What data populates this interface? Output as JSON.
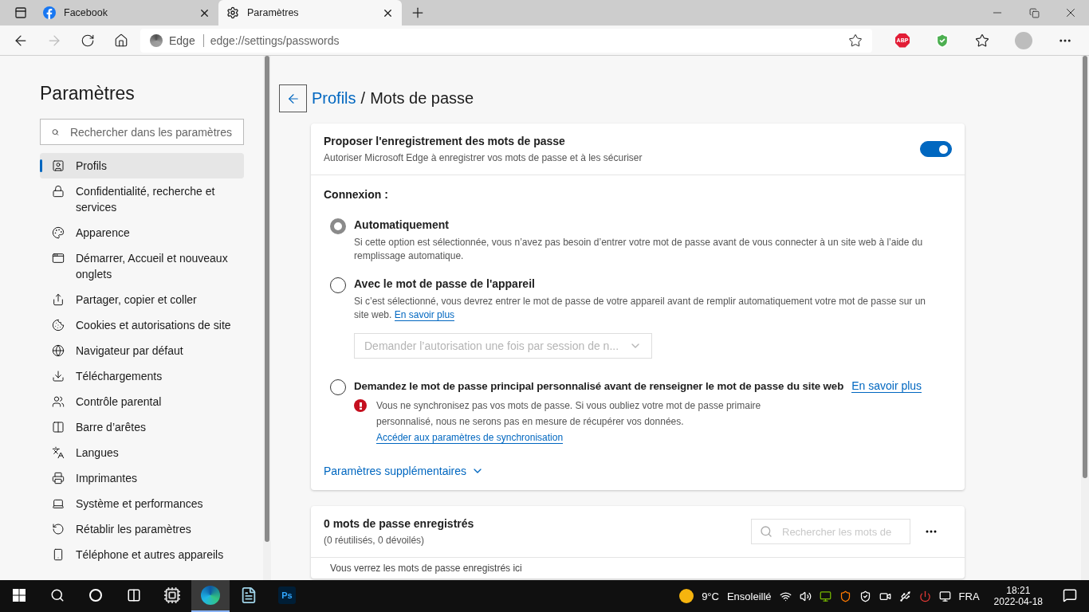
{
  "tabs": [
    {
      "title": "Facebook",
      "selected": false
    },
    {
      "title": "Paramètres",
      "selected": true
    }
  ],
  "address": {
    "site_label": "Edge",
    "url": "edge://settings/passwords",
    "adblock_badge": "ABP"
  },
  "sidebar": {
    "title": "Paramètres",
    "search_placeholder": "Rechercher dans les paramètres",
    "items": [
      {
        "label": "Profils",
        "selected": true
      },
      {
        "label": "Confidentialité, recherche et services",
        "selected": false
      },
      {
        "label": "Apparence",
        "selected": false
      },
      {
        "label": "Démarrer, Accueil et nouveaux onglets",
        "selected": false
      },
      {
        "label": "Partager, copier et coller",
        "selected": false
      },
      {
        "label": "Cookies et autorisations de site",
        "selected": false
      },
      {
        "label": "Navigateur par défaut",
        "selected": false
      },
      {
        "label": "Téléchargements",
        "selected": false
      },
      {
        "label": "Contrôle parental",
        "selected": false
      },
      {
        "label": "Barre d’arêtes",
        "selected": false
      },
      {
        "label": "Langues",
        "selected": false
      },
      {
        "label": "Imprimantes",
        "selected": false
      },
      {
        "label": "Système et performances",
        "selected": false
      },
      {
        "label": "Rétablir les paramètres",
        "selected": false
      },
      {
        "label": "Téléphone et autres appareils",
        "selected": false
      }
    ]
  },
  "breadcrumb": {
    "parent": "Profils",
    "separator": "/",
    "current": "Mots de passe"
  },
  "offer": {
    "title": "Proposer l'enregistrement des mots de passe",
    "description": "Autoriser Microsoft Edge à enregistrer vos mots de passe et à les sécuriser",
    "on": true
  },
  "connexion": {
    "heading": "Connexion :",
    "options": [
      {
        "kind": "plain",
        "label": "Automatiquement",
        "selected": true,
        "description": "Si cette option est sélectionnée, vous n’avez pas besoin d’entrer votre mot de passe avant de vous connecter à un site web à l’aide du remplissage automatique."
      },
      {
        "kind": "device",
        "label": "Avec le mot de passe de l'appareil",
        "selected": false,
        "description": "Si c’est sélectionné, vous devrez entrer le mot de passe de votre appareil avant de remplir automatiquement votre mot de passe sur un site web.",
        "link": "En savoir plus",
        "dropdown": {
          "value": "Demander l’autorisation une fois par session de n...",
          "disabled": true
        }
      },
      {
        "kind": "primary",
        "label": "Demandez le mot de passe principal personnalisé avant de renseigner le mot de passe du site web",
        "selected": false,
        "link": "En savoir plus",
        "warning": {
          "text": "Vous ne synchronisez pas vos mots de passe. Si vous oubliez votre mot de passe primaire personnalisé, nous ne serons pas en mesure de récupérer vos données.",
          "link": "Accéder aux paramètres de synchronisation"
        }
      }
    ],
    "more": "Paramètres supplémentaires"
  },
  "saved": {
    "title": "0 mots de passe enregistrés",
    "subtitle": "(0 réutilisés, 0 dévoilés)",
    "search_placeholder": "Rechercher les mots de",
    "empty_text": "Vous verrez les mots de passe enregistrés ici"
  },
  "taskbar": {
    "apps": [
      {
        "kind": "tool",
        "active": false
      },
      {
        "kind": "edge",
        "active": true
      },
      {
        "kind": "notepad",
        "active": false
      },
      {
        "kind": "photoshop",
        "label": "Ps",
        "active": false
      }
    ],
    "weather": {
      "temp": "9°C",
      "condition": "Ensoleillé"
    },
    "language": "FRA",
    "time": "18:21",
    "date": "2022-04-18"
  }
}
